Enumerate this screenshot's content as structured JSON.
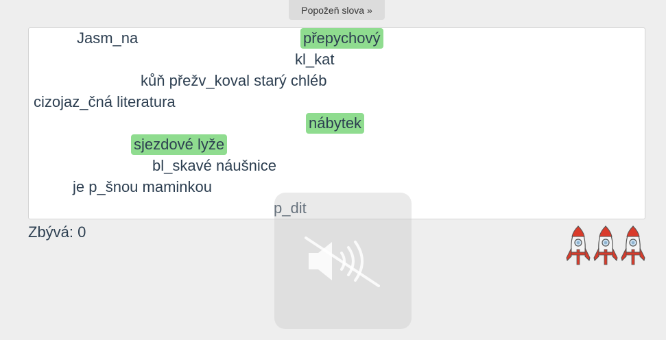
{
  "toolbar": {
    "hint_label": "Popožeň slova »"
  },
  "words": [
    {
      "text": "Jasm_na",
      "done": false
    },
    {
      "text": "přepychový",
      "done": true
    },
    {
      "text": "kl_kat",
      "done": false
    },
    {
      "text": "kůň přežv_koval starý chléb",
      "done": false
    },
    {
      "text": "cizojaz_čná literatura",
      "done": false
    },
    {
      "text": "nábytek",
      "done": true
    },
    {
      "text": "sjezdové lyže",
      "done": true
    },
    {
      "text": "bl_skavé náušnice",
      "done": false
    },
    {
      "text": "je p_šnou maminkou",
      "done": false
    },
    {
      "text": "p_dit",
      "done": false
    }
  ],
  "status": {
    "remaining_label": "Zbývá: 0"
  },
  "lives": {
    "count": 3,
    "icon": "rocket-icon"
  },
  "sound": {
    "icon": "speaker-muted-icon",
    "muted": true
  },
  "colors": {
    "correct": "#8fdc8f",
    "text": "#2c3e50"
  }
}
